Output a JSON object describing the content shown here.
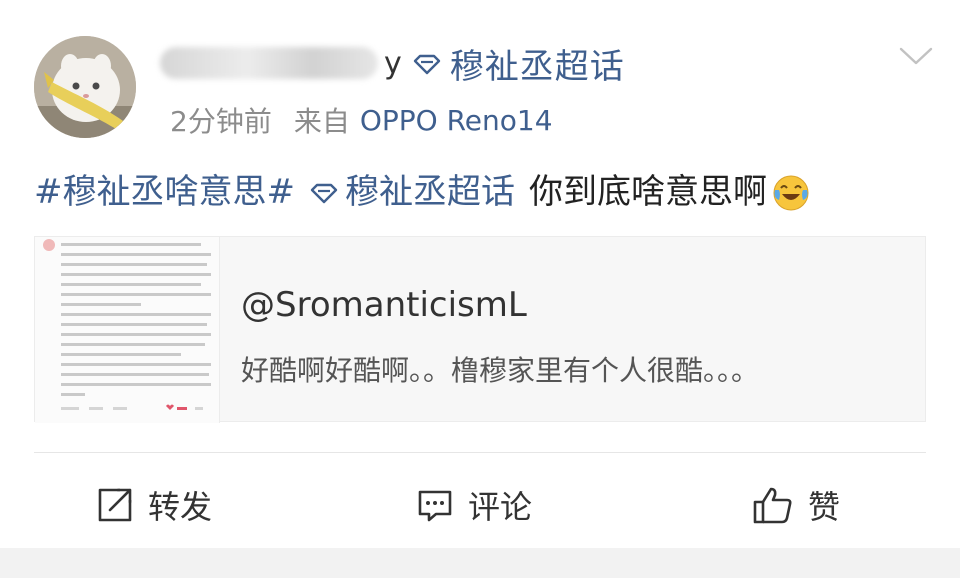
{
  "post": {
    "author_suffix": "y",
    "author_topic": "穆祉丞超话",
    "time": "2分钟前",
    "from_label": "来自",
    "device": "OPPO Reno14",
    "content": {
      "hashtag": "#穆祉丞啥意思#",
      "super_topic": "穆祉丞超话",
      "text": "你到底啥意思啊",
      "emoji": "laughing-crying-emoji"
    }
  },
  "card": {
    "title": "@SromanticismL",
    "desc": "好酷啊好酷啊。。橹穆家里有个人很酷。。。"
  },
  "actions": {
    "repost": "转发",
    "comment": "评论",
    "like": "赞"
  },
  "colors": {
    "link": "#3f5f8e",
    "meta": "#8c8c8c",
    "text": "#222222"
  }
}
